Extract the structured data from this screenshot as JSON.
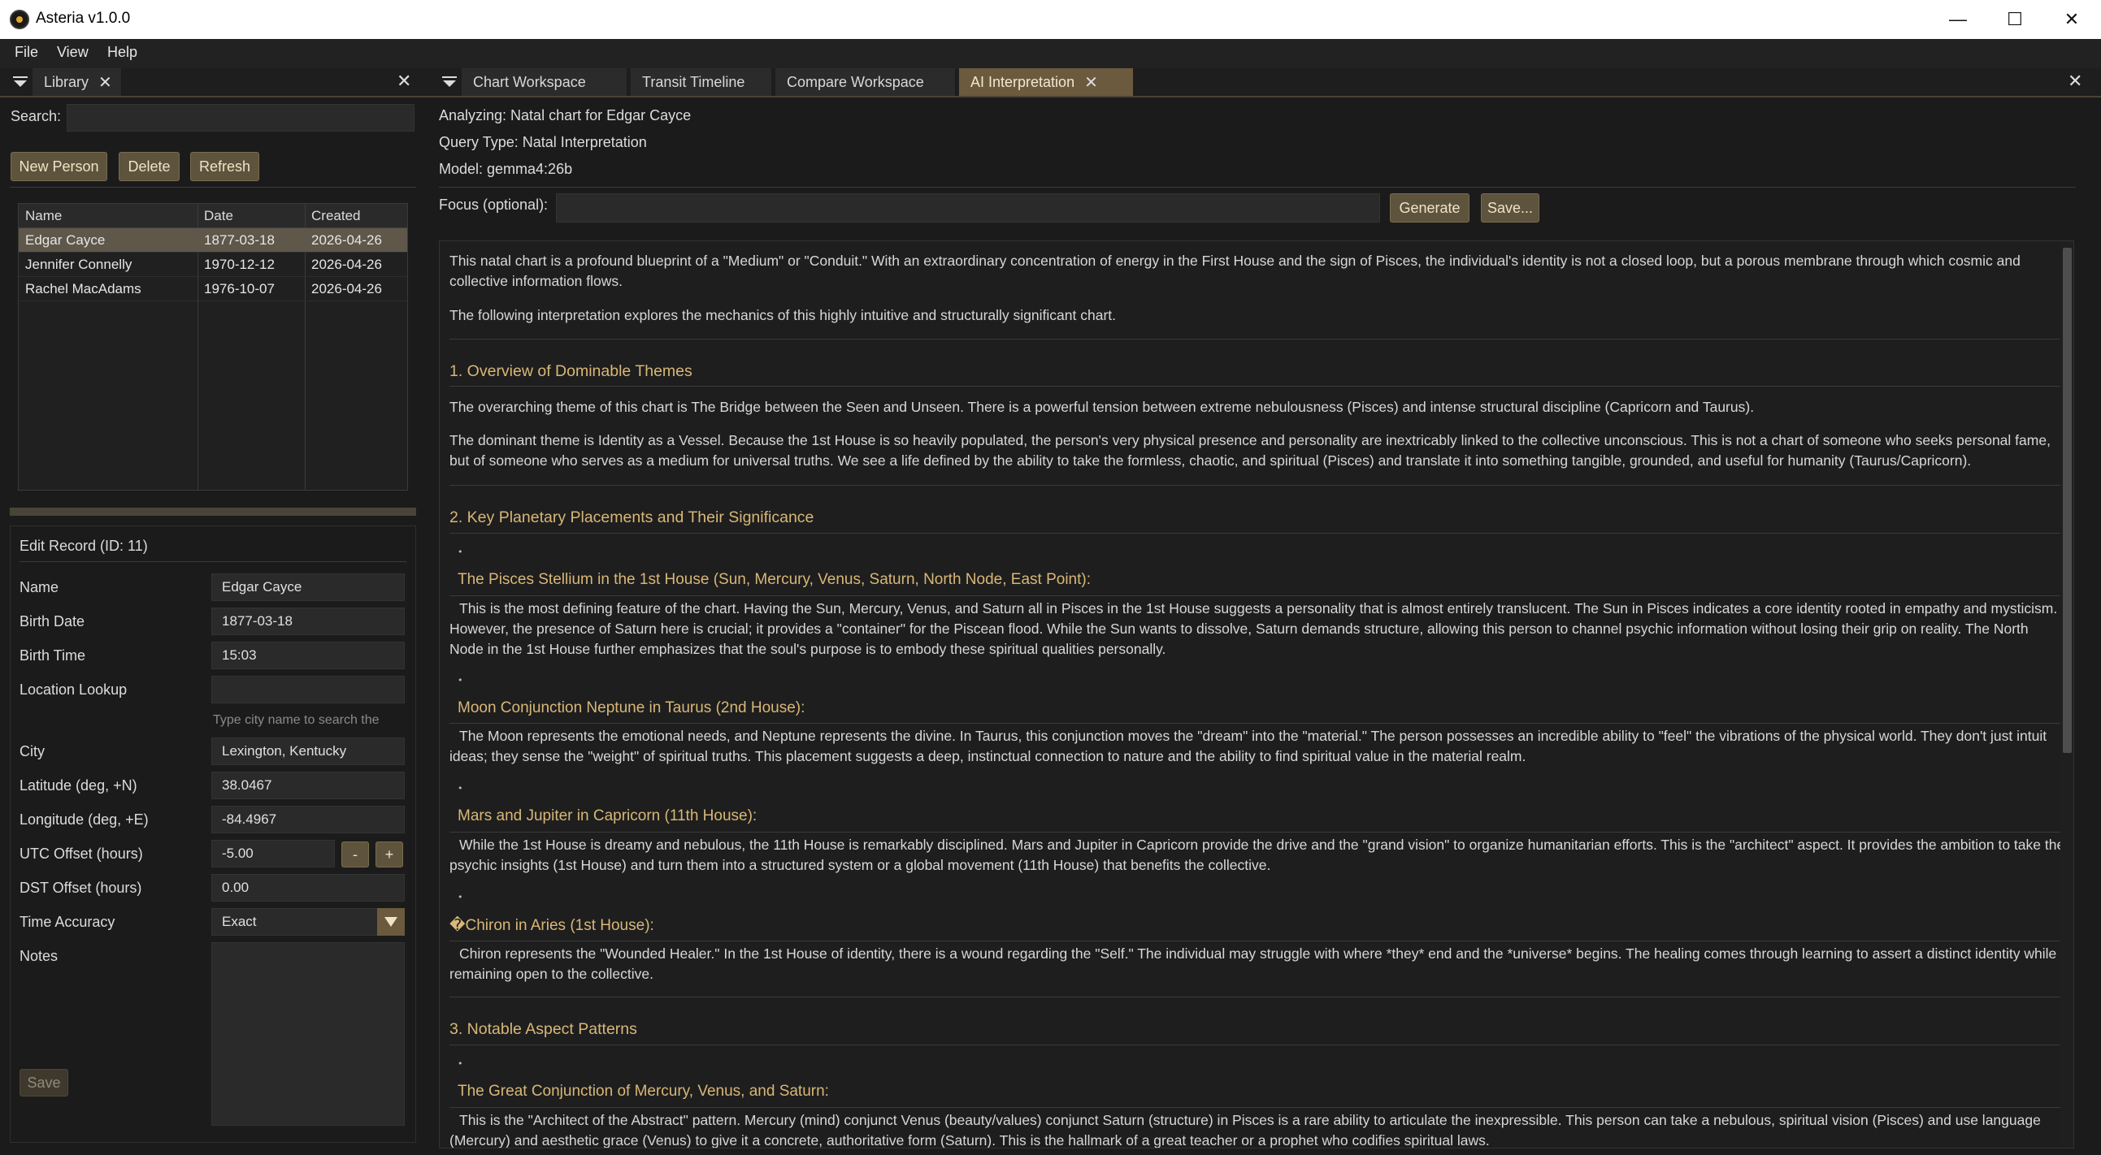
{
  "window": {
    "title": "Asteria v1.0.0",
    "minimize": "—",
    "maximize": "☐",
    "close": "✕"
  },
  "menu": [
    "File",
    "View",
    "Help"
  ],
  "library": {
    "tab_label": "Library",
    "search_label": "Search:",
    "search_value": "",
    "buttons": {
      "new_person": "New Person",
      "delete": "Delete",
      "refresh": "Refresh"
    },
    "columns": [
      "Name",
      "Date",
      "Created"
    ],
    "rows": [
      [
        "Edgar Cayce",
        "1877-03-18",
        "2026-04-26"
      ],
      [
        "Jennifer Connelly",
        "1970-12-12",
        "2026-04-26"
      ],
      [
        "Rachel MacAdams",
        "1976-10-07",
        "2026-04-26"
      ]
    ]
  },
  "edit_record": {
    "title": "Edit Record  (ID: 11)",
    "fields": {
      "name": {
        "label": "Name",
        "value": "Edgar Cayce"
      },
      "birth_date": {
        "label": "Birth Date",
        "value": "1877-03-18"
      },
      "birth_time": {
        "label": "Birth Time",
        "value": "15:03"
      },
      "location_lookup": {
        "label": "Location Lookup",
        "value": "",
        "hint": "Type city name to search the"
      },
      "city": {
        "label": "City",
        "value": "Lexington, Kentucky"
      },
      "latitude": {
        "label": "Latitude (deg, +N)",
        "value": "38.0467"
      },
      "longitude": {
        "label": "Longitude (deg, +E)",
        "value": "-84.4967"
      },
      "utc_offset": {
        "label": "UTC Offset (hours)",
        "value": "-5.00",
        "minus": "-",
        "plus": "+"
      },
      "dst_offset": {
        "label": "DST Offset (hours)",
        "value": "0.00"
      },
      "time_accuracy": {
        "label": "Time Accuracy",
        "value": "Exact"
      },
      "notes": {
        "label": "Notes",
        "value": ""
      }
    },
    "save_label": "Save"
  },
  "tabs": [
    "Chart Workspace",
    "Transit Timeline",
    "Compare Workspace",
    "AI Interpretation"
  ],
  "ai": {
    "analyzing": "Analyzing: Natal chart for Edgar Cayce",
    "query_type": "Query Type: Natal Interpretation",
    "model": "Model: gemma4:26b",
    "focus_label": "Focus (optional):",
    "focus_value": "",
    "generate_label": "Generate",
    "save_label": "Save...",
    "intro1": "This natal chart is a profound blueprint of a \"Medium\" or \"Conduit.\" With an extraordinary concentration of energy in the First House and the sign of Pisces, the individual's identity is not a closed loop, but a porous membrane through which cosmic and collective information flows.",
    "intro2": "The following interpretation explores the mechanics of this highly intuitive and structurally significant chart.",
    "s1_title": "1. Overview of Dominable Themes",
    "s1_p1": "The overarching theme of this chart is The Bridge between the Seen and Unseen. There is a powerful tension between extreme nebulousness (Pisces) and intense structural discipline (Capricorn and Taurus).",
    "s1_p2": "The dominant theme is Identity as a Vessel. Because the 1st House is so heavily populated, the person's very physical presence and personality are inextricably linked to the collective unconscious. This is not a chart of someone who seeks personal fame, but of someone who serves as a medium for universal truths. We see a life defined by the ability to take the formless, chaotic, and spiritual (Pisces) and translate it into something tangible, grounded, and useful for humanity (Taurus/Capricorn).",
    "s2_title": "2. Key Planetary Placements and Their Significance",
    "s2_h1": "The Pisces Stellium in the 1st House (Sun, Mercury, Venus, Saturn, North Node, East Point):",
    "s2_p1": "This is the most defining feature of the chart. Having the Sun, Mercury, Venus, and Saturn all in Pisces in the 1st House suggests a personality that is almost entirely translucent. The Sun in Pisces indicates a core identity rooted in empathy and mysticism. However, the presence of Saturn here is crucial; it provides a \"container\" for the Piscean flood. While the Sun wants to dissolve, Saturn demands structure, allowing this person to channel psychic information without losing their grip on reality. The North Node in the 1st House further emphasizes that the soul's purpose is to embody these spiritual qualities personally.",
    "s2_h2": "Moon Conjunction Neptune in Taurus (2nd House):",
    "s2_p2": "The Moon represents the emotional needs, and Neptune represents the divine. In Taurus, this conjunction moves the \"dream\" into the \"material.\" The person possesses an incredible ability to \"feel\" the vibrations of the physical world. They don't just intuit ideas; they sense the \"weight\" of spiritual truths. This placement suggests a deep, instinctual connection to nature and the ability to find spiritual value in the material realm.",
    "s2_h3": "Mars and Jupiter in Capricorn (11th House):",
    "s2_p3": "While the 1st House is dreamy and nebulous, the 11th House is remarkably disciplined. Mars and Jupiter in Capricorn provide the drive and the \"grand vision\" to organize humanitarian efforts. This is the \"architect\" aspect. It provides the ambition to take the psychic insights (1st House) and turn them into a structured system or a global movement (11th House) that benefits the collective.",
    "s2_h4": "�Chiron in Aries (1st House):",
    "s2_p4": "Chiron represents the \"Wounded Healer.\" In the 1st House of identity, there is a wound regarding the \"Self.\" The individual may struggle with where *they* end and the *universe* begins. The healing comes through learning to assert a distinct identity while remaining open to the collective.",
    "s3_title": "3. Notable Aspect Patterns",
    "s3_h1": "The Great Conjunction of Mercury, Venus, and Saturn:",
    "s3_p1": "This is the \"Architect of the Abstract\" pattern. Mercury (mind) conjunct Venus (beauty/values) conjunct Saturn (structure) in Pisces is a rare ability to articulate the inexpressible. This person can take a nebulous, spiritual vision (Pisces) and use language (Mercury) and aesthetic grace (Venus) to give it a concrete, authoritative form (Saturn). This is the hallmark of a great teacher or a prophet who codifies spiritual laws."
  }
}
